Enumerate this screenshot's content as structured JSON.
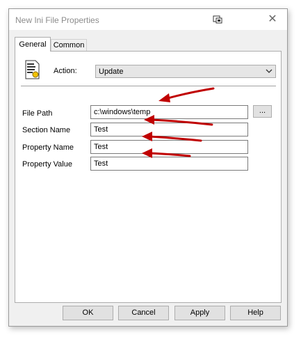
{
  "window": {
    "title": "New Ini File Properties"
  },
  "tabs": [
    {
      "label": "General"
    },
    {
      "label": "Common"
    }
  ],
  "action": {
    "label": "Action:",
    "selected": "Update"
  },
  "fields": [
    {
      "label": "File Path",
      "value": "c:\\windows\\temp"
    },
    {
      "label": "Section Name",
      "value": "Test"
    },
    {
      "label": "Property Name",
      "value": "Test"
    },
    {
      "label": "Property Value",
      "value": "Test"
    }
  ],
  "browse_label": "...",
  "buttons": {
    "ok": "OK",
    "cancel": "Cancel",
    "apply": "Apply",
    "help": "Help"
  },
  "colors": {
    "annotation_arrow": "#c00000"
  }
}
